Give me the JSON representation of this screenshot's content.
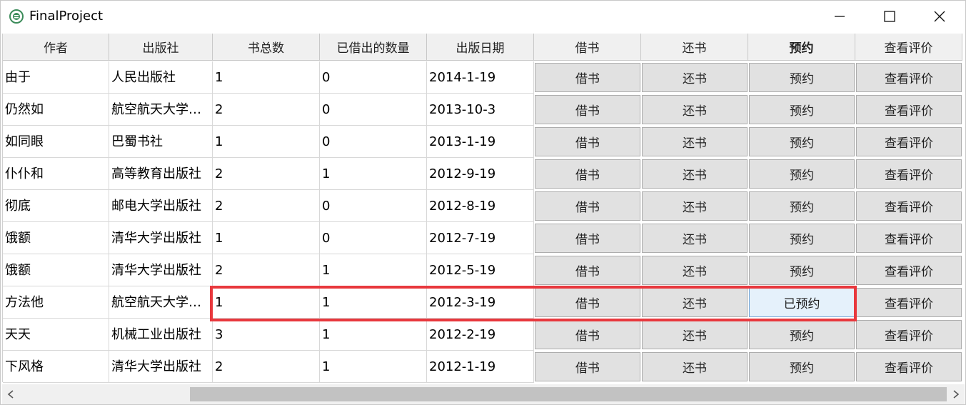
{
  "window": {
    "title": "FinalProject"
  },
  "table": {
    "columns": [
      "作者",
      "出版社",
      "书总数",
      "已借出的数量",
      "出版日期",
      "借书",
      "还书",
      "预约",
      "查看评价"
    ],
    "rows": [
      {
        "author": "由于",
        "publisher": "人民出版社",
        "total": "1",
        "borrowed": "0",
        "date": "2014-1-19",
        "borrow": "借书",
        "return": "还书",
        "reserve": "预约",
        "review": "查看评价"
      },
      {
        "author": "仍然如",
        "publisher": "航空航天大学…",
        "total": "2",
        "borrowed": "0",
        "date": "2013-10-3",
        "borrow": "借书",
        "return": "还书",
        "reserve": "预约",
        "review": "查看评价"
      },
      {
        "author": "如同眼",
        "publisher": "巴蜀书社",
        "total": "1",
        "borrowed": "0",
        "date": "2013-1-19",
        "borrow": "借书",
        "return": "还书",
        "reserve": "预约",
        "review": "查看评价"
      },
      {
        "author": "仆仆和",
        "publisher": "高等教育出版社",
        "total": "2",
        "borrowed": "1",
        "date": "2012-9-19",
        "borrow": "借书",
        "return": "还书",
        "reserve": "预约",
        "review": "查看评价"
      },
      {
        "author": "彻底",
        "publisher": "邮电大学出版社",
        "total": "2",
        "borrowed": "0",
        "date": "2012-8-19",
        "borrow": "借书",
        "return": "还书",
        "reserve": "预约",
        "review": "查看评价"
      },
      {
        "author": "饿额",
        "publisher": "清华大学出版社",
        "total": "1",
        "borrowed": "0",
        "date": "2012-7-19",
        "borrow": "借书",
        "return": "还书",
        "reserve": "预约",
        "review": "查看评价"
      },
      {
        "author": "饿额",
        "publisher": "清华大学出版社",
        "total": "2",
        "borrowed": "1",
        "date": "2012-5-19",
        "borrow": "借书",
        "return": "还书",
        "reserve": "预约",
        "review": "查看评价"
      },
      {
        "author": "方法他",
        "publisher": "航空航天大学…",
        "total": "1",
        "borrowed": "1",
        "date": "2012-3-19",
        "borrow": "借书",
        "return": "还书",
        "reserve": "已预约",
        "review": "查看评价"
      },
      {
        "author": "天天",
        "publisher": "机械工业出版社",
        "total": "3",
        "borrowed": "1",
        "date": "2012-2-19",
        "borrow": "借书",
        "return": "还书",
        "reserve": "预约",
        "review": "查看评价"
      },
      {
        "author": "下风格",
        "publisher": "清华大学出版社",
        "total": "2",
        "borrowed": "1",
        "date": "2012-1-19",
        "borrow": "借书",
        "return": "还书",
        "reserve": "预约",
        "review": "查看评价"
      }
    ]
  },
  "colors": {
    "highlight": "#e8383d",
    "button_bg": "#e1e1e1",
    "header_bg": "#f0f0f0",
    "selected_button_bg": "#e5f1fb"
  },
  "icons": {
    "app": "app-logo-icon",
    "minimize": "minimize-icon",
    "maximize": "maximize-icon",
    "close": "close-icon",
    "scroll_left": "chevron-left-icon",
    "scroll_right": "chevron-right-icon"
  }
}
